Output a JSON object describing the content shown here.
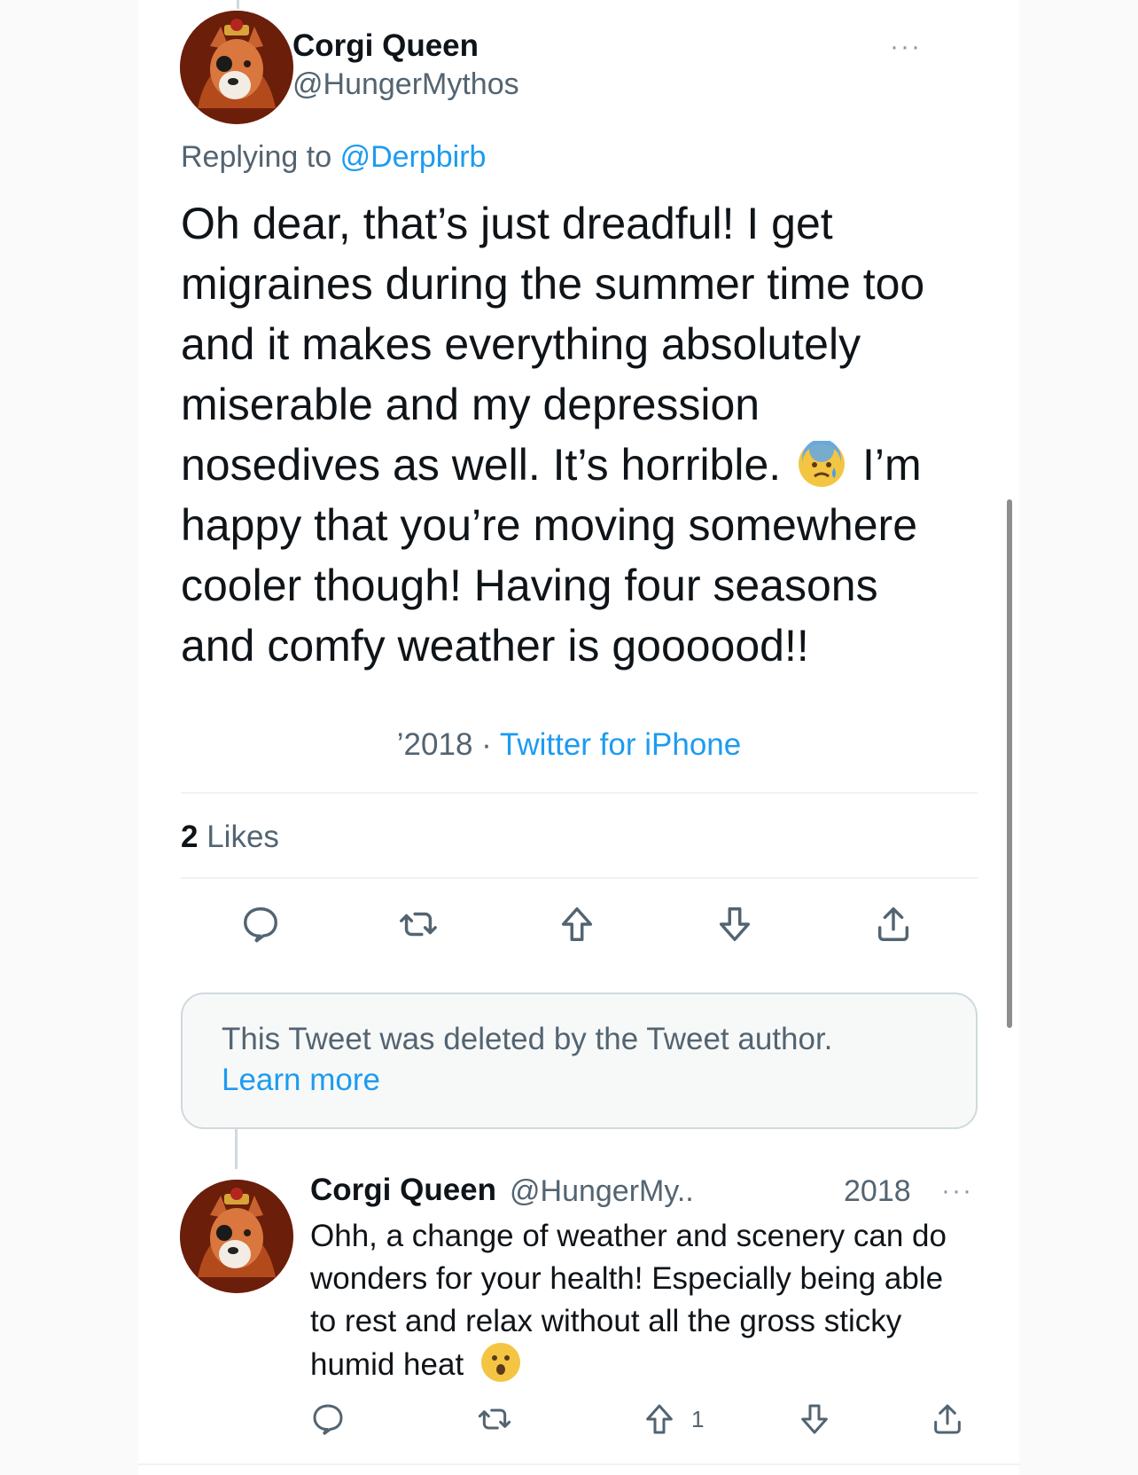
{
  "tweet": {
    "author_name": "Corgi Queen",
    "author_handle": "@HungerMythos",
    "more_glyph": "···",
    "replying_prefix": "Replying to",
    "replying_to": "@Derpbirb",
    "text_part1": "Oh dear, that’s just dreadful! I get migraines during the summer time too and it makes everything absolutely miserable and my depression nosedives as well. It’s horrible.",
    "emoji": "😰",
    "text_part2": "I’m happy that you’re moving somewhere cooler though! Having four seasons and comfy weather is goooood!!",
    "date": "’2018",
    "separator": "·",
    "source": "Twitter for iPhone",
    "likes_count": "2",
    "likes_label": "Likes",
    "actions": [
      "reply-icon",
      "retweet-icon",
      "upvote-icon",
      "downvote-icon",
      "share-icon"
    ]
  },
  "deleted_notice": {
    "text": "This Tweet was deleted by the Tweet author.",
    "link": "Learn more"
  },
  "reply": {
    "author_name": "Corgi Queen",
    "author_handle": "@HungerMy..",
    "date": "2018",
    "more_glyph": "···",
    "text": "Ohh, a change of weather and scenery can do wonders for your health! Especially being able to rest and relax without all the gross sticky humid heat",
    "emoji": "😮",
    "upvote_count": "1",
    "actions": [
      "reply-icon",
      "retweet-icon",
      "upvote-icon",
      "downvote-icon",
      "share-icon"
    ]
  },
  "colors": {
    "accent": "#1d9bf0",
    "secondary_text": "#536471",
    "primary_text": "#0f1419",
    "icon": "#536471"
  }
}
